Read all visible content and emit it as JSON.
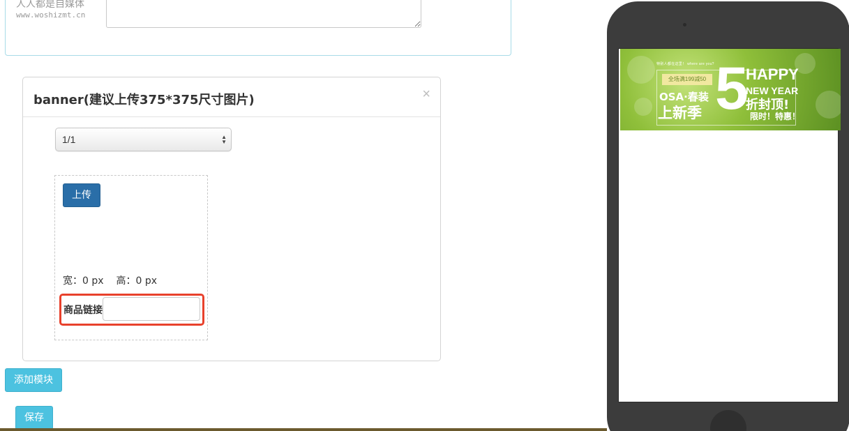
{
  "watermark": {
    "name": "人人都是自媒体",
    "url": "www.woshizmt.cn"
  },
  "module": {
    "title": "banner(建议上传375*375尺寸图片)",
    "close_label": "×",
    "page_select_value": "1/1",
    "upload_label": "上传",
    "width_label": "宽：0 px",
    "height_label": "高：0 px",
    "link_label": "商品链接",
    "link_value": ""
  },
  "actions": {
    "add_module_label": "添加模块",
    "save_label": "保存"
  },
  "preview": {
    "banner": {
      "top_line": "特别人都在这里！ where are you?",
      "promo": "全场满199减50",
      "line1": "OSA·春装",
      "line2": "上新季",
      "big_number": "5",
      "happy": "HAPPY",
      "new_year": "NEW YEAR",
      "discount": "折封顶!",
      "limited": "限时！特惠！"
    }
  },
  "colors": {
    "primary_button": "#2a6ea8",
    "info_button": "#4cc2e0",
    "highlight_border": "#e8412c",
    "phone_body": "#3c3c3c",
    "panel_border_top": "#a8dbe8"
  }
}
